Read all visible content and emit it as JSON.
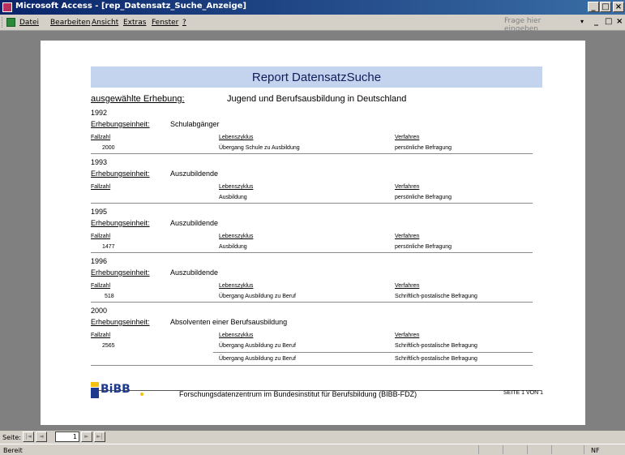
{
  "window": {
    "title": "Microsoft Access - [rep_Datensatz_Suche_Anzeige]",
    "controls": [
      "_",
      "□",
      "×"
    ]
  },
  "menu": {
    "items": [
      "Datei",
      "Bearbeiten",
      "Ansicht",
      "Extras",
      "Fenster",
      "?"
    ],
    "help_placeholder": "Frage hier eingeben",
    "mdi_controls": [
      "_",
      "□",
      "×"
    ]
  },
  "report": {
    "title": "Report DatensatzSuche",
    "erhebung_label": "ausgewählte Erhebung:",
    "erhebung_value": "Jugend und Berufsausbildung in Deutschland",
    "einheit_label": "Erhebungseinheit:",
    "col_fallzahl": "Fallzahl",
    "col_lebenszyklus": "Lebenszyklus",
    "col_verfahren": "Verfahren",
    "groups": [
      {
        "year": "1992",
        "einheit": "Schulabgänger",
        "rows": [
          {
            "fallzahl": "2000",
            "lebenszyklus": "Übergang Schule zu Ausbildung",
            "verfahren": "persönliche Befragung"
          }
        ]
      },
      {
        "year": "1993",
        "einheit": "Auszubildende",
        "rows": [
          {
            "fallzahl": "",
            "lebenszyklus": "Ausbildung",
            "verfahren": "persönliche Befragung"
          }
        ]
      },
      {
        "year": "1995",
        "einheit": "Auszubildende",
        "rows": [
          {
            "fallzahl": "1477",
            "lebenszyklus": "Ausbildung",
            "verfahren": "persönliche Befragung"
          }
        ]
      },
      {
        "year": "1996",
        "einheit": "Auszubildende",
        "rows": [
          {
            "fallzahl": "518",
            "lebenszyklus": "Übergang Ausbildung zu Beruf",
            "verfahren": "Schriftlich-postalische Befragung"
          }
        ]
      },
      {
        "year": "2000",
        "einheit": "Absolventen einer Berufsausbildung",
        "rows": [
          {
            "fallzahl": "2565",
            "lebenszyklus": "Übergang Ausbildung zu Beruf",
            "verfahren": "Schriftlich-postalische Befragung"
          },
          {
            "fallzahl": "",
            "lebenszyklus": "Übergang Ausbildung zu Beruf",
            "verfahren": "Schriftlich-postalische Befragung"
          }
        ]
      }
    ],
    "footer": {
      "logo_text": "BiBB",
      "institution": "Forschungsdatenzentrum im Bundesinstitut für Berufsbildung (BIBB-FDZ)",
      "page_info": "SEITE 1 VON 1"
    }
  },
  "nav": {
    "label": "Seite:",
    "current_page": "1",
    "buttons": [
      "|◄",
      "◄",
      "►",
      "►|"
    ]
  },
  "status": {
    "text": "Bereit",
    "mode": "NF"
  },
  "colors": {
    "banner": "#c5d4ee",
    "titlebar": "#0a246a",
    "logo_blue": "#1d3a8e",
    "logo_yellow": "#f4c10e"
  }
}
